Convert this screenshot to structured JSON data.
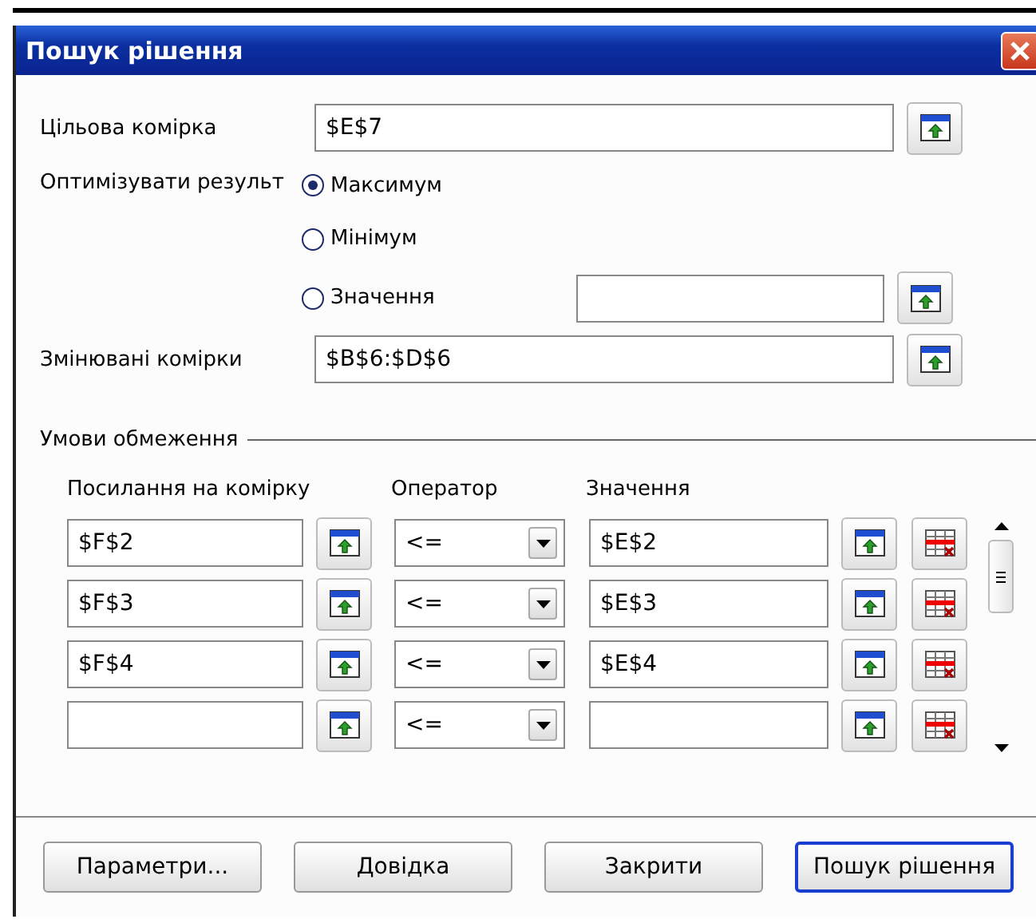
{
  "window": {
    "title": "Пошук рішення"
  },
  "target_cell": {
    "label": "Цільова комірка",
    "value": "$E$7"
  },
  "optimize": {
    "label": "Оптимізувати результ",
    "options": [
      {
        "label": "Максимум",
        "selected": true
      },
      {
        "label": "Мінімум",
        "selected": false
      },
      {
        "label": "Значення",
        "selected": false
      }
    ]
  },
  "changing_cells": {
    "label": "Змінювані комірки",
    "value": "$B$6:$D$6"
  },
  "constraints": {
    "title": "Умови обмеження",
    "columns": [
      "Посилання на комірку",
      "Оператор",
      "Значення"
    ],
    "rows": [
      {
        "cell": "$F$2",
        "operator": "<=",
        "value": "$E$2"
      },
      {
        "cell": "$F$3",
        "operator": "<=",
        "value": "$E$3"
      },
      {
        "cell": "$F$4",
        "operator": "<=",
        "value": "$E$4"
      },
      {
        "operator": "<="
      }
    ]
  },
  "buttons": [
    {
      "label": "Параметри...",
      "default": false
    },
    {
      "label": "Довідка",
      "default": false
    },
    {
      "label": "Закрити",
      "default": false
    },
    {
      "label": "Пошук рішення",
      "default": true
    }
  ]
}
